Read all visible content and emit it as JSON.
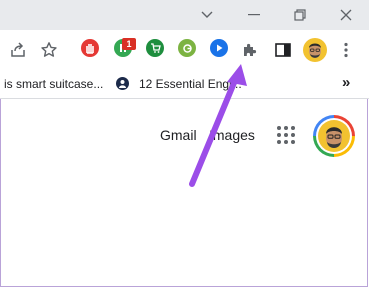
{
  "window_controls": {
    "tab_search": "chevron-down-icon",
    "minimize": "minimize-icon",
    "restore": "restore-icon",
    "close": "close-icon"
  },
  "toolbar": {
    "icons": [
      "share-icon",
      "star-icon",
      "adblock-extension-icon",
      "extension-green-icon",
      "shopping-extension-icon",
      "grammar-extension-icon",
      "play-extension-icon",
      "puzzle-extensions-icon",
      "side-panel-icon",
      "profile-avatar-icon",
      "more-menu-icon"
    ],
    "badge_count": "1"
  },
  "bookmarks": {
    "items": [
      {
        "label": "is smart suitcase..."
      },
      {
        "label": "12 Essential Engl..."
      }
    ],
    "overflow": "»"
  },
  "google_bar": {
    "gmail_label": "Gmail",
    "images_label": "Images"
  },
  "colors": {
    "annotation_arrow": "#9b4de8",
    "titlebar": "#e8eaed"
  }
}
